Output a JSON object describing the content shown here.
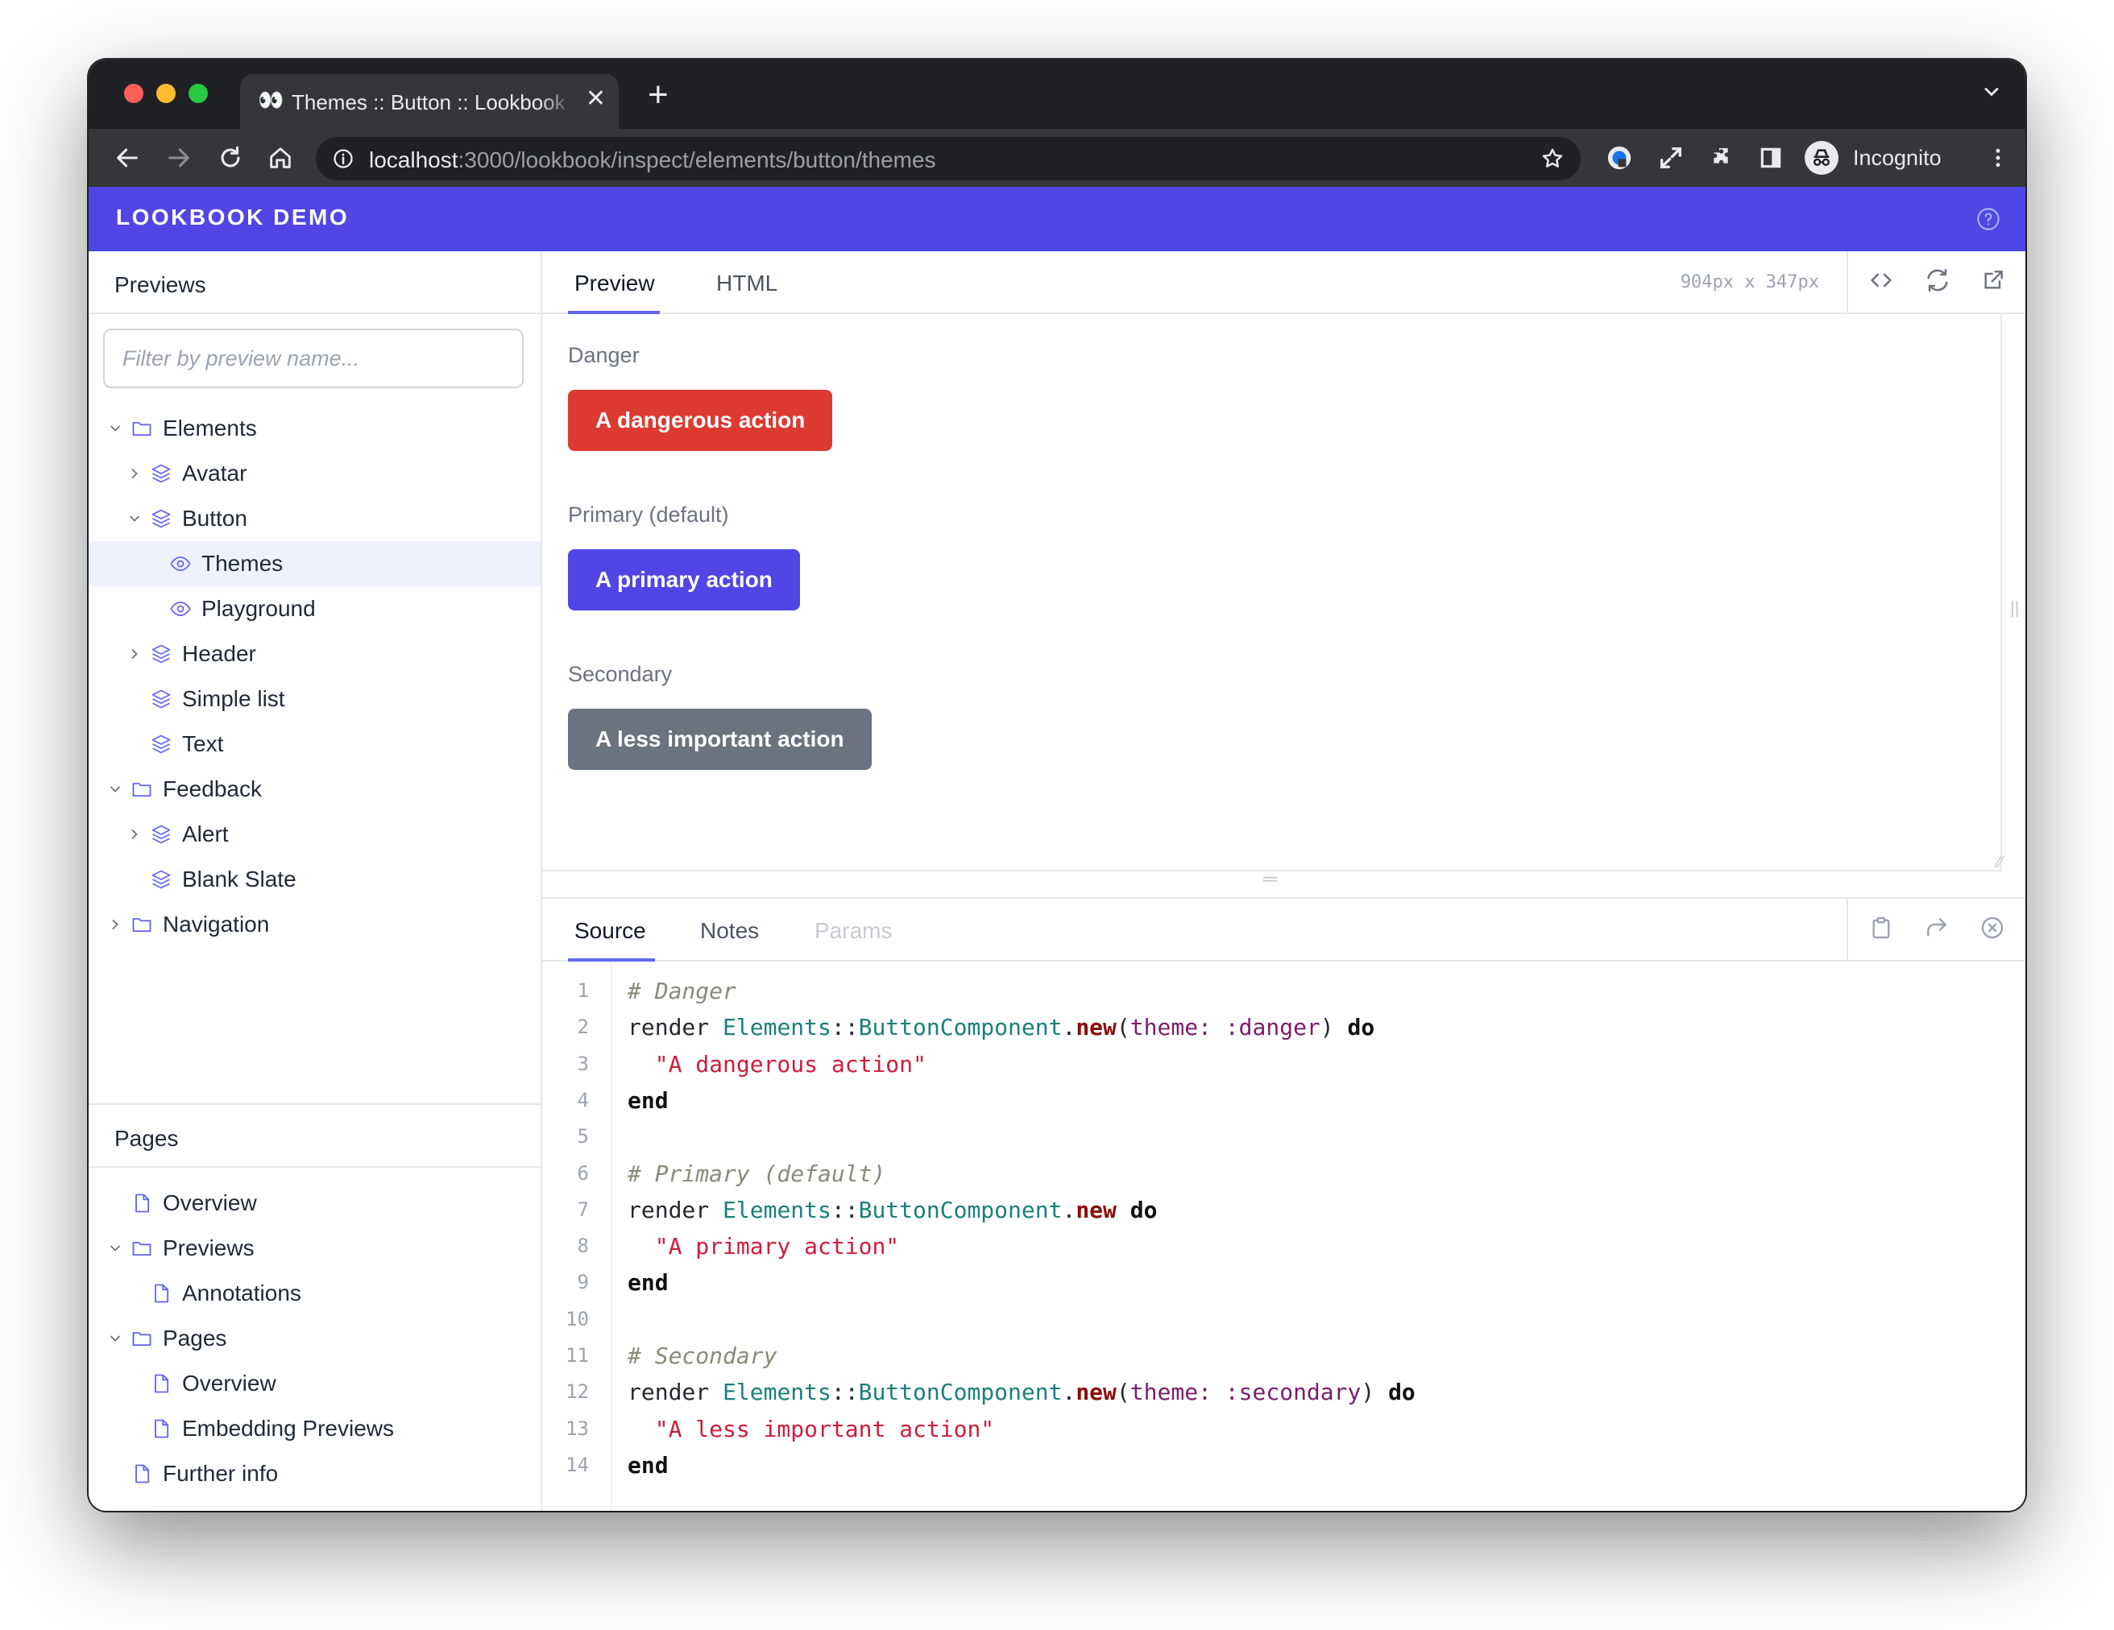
{
  "browser": {
    "tab_title": "Themes :: Button :: Lookbook Demo",
    "tab_favicon": "👀",
    "url_host": "localhost",
    "url_rest": ":3000/lookbook/inspect/elements/button/themes",
    "profile_label": "Incognito"
  },
  "app": {
    "title": "LOOKBOOK DEMO",
    "accent_color": "#4f46e5"
  },
  "sidebar": {
    "previews_heading": "Previews",
    "filter_placeholder": "Filter by preview name...",
    "tree": [
      {
        "label": "Elements",
        "icon": "folder-icon",
        "chevron": "down"
      },
      {
        "label": "Avatar",
        "icon": "layers-icon",
        "chevron": "right"
      },
      {
        "label": "Button",
        "icon": "layers-icon",
        "chevron": "down"
      },
      {
        "label": "Themes",
        "icon": "eye-icon",
        "chevron": "",
        "active": true
      },
      {
        "label": "Playground",
        "icon": "eye-icon",
        "chevron": ""
      },
      {
        "label": "Header",
        "icon": "layers-icon",
        "chevron": "right"
      },
      {
        "label": "Simple list",
        "icon": "layers-icon",
        "chevron": ""
      },
      {
        "label": "Text",
        "icon": "layers-icon",
        "chevron": ""
      },
      {
        "label": "Feedback",
        "icon": "folder-icon",
        "chevron": "down"
      },
      {
        "label": "Alert",
        "icon": "layers-icon",
        "chevron": "right"
      },
      {
        "label": "Blank Slate",
        "icon": "layers-icon",
        "chevron": ""
      },
      {
        "label": "Navigation",
        "icon": "folder-icon",
        "chevron": "right"
      }
    ],
    "pages_heading": "Pages",
    "pages": [
      {
        "label": "Overview",
        "icon": "file-icon"
      },
      {
        "label": "Previews",
        "icon": "folder-icon",
        "chevron": "down"
      },
      {
        "label": "Annotations",
        "icon": "file-icon"
      },
      {
        "label": "Pages",
        "icon": "folder-icon",
        "chevron": "down"
      },
      {
        "label": "Overview",
        "icon": "file-icon"
      },
      {
        "label": "Embedding Previews",
        "icon": "file-icon"
      },
      {
        "label": "Further info",
        "icon": "file-icon"
      }
    ]
  },
  "main": {
    "tabs": [
      "Preview",
      "HTML"
    ],
    "dimensions": "904px x 347px",
    "preview": {
      "sections": [
        {
          "label": "Danger",
          "button": "A dangerous action",
          "color": "#dc3a31"
        },
        {
          "label": "Primary (default)",
          "button": "A primary action",
          "color": "#4f46e5"
        },
        {
          "label": "Secondary",
          "button": "A less important action",
          "color": "#6b7280"
        }
      ]
    },
    "bottom_tabs": [
      "Source",
      "Notes",
      "Params"
    ],
    "source": {
      "line_numbers": [
        "1",
        "2",
        "3",
        "4",
        "5",
        "6",
        "7",
        "8",
        "9",
        "10",
        "11",
        "12",
        "13",
        "14"
      ],
      "lines": [
        [
          {
            "t": "# Danger",
            "c": "comment"
          }
        ],
        [
          {
            "t": "render ",
            "c": "plain"
          },
          {
            "t": "Elements",
            "c": "const"
          },
          {
            "t": "::",
            "c": "plain"
          },
          {
            "t": "ButtonComponent",
            "c": "const"
          },
          {
            "t": ".",
            "c": "plain"
          },
          {
            "t": "new",
            "c": "meth"
          },
          {
            "t": "(",
            "c": "plain"
          },
          {
            "t": "theme:",
            "c": "sym"
          },
          {
            "t": " ",
            "c": "plain"
          },
          {
            "t": ":danger",
            "c": "sym"
          },
          {
            "t": ") ",
            "c": "plain"
          },
          {
            "t": "do",
            "c": "kw"
          }
        ],
        [
          {
            "t": "  ",
            "c": "plain"
          },
          {
            "t": "\"A dangerous action\"",
            "c": "str"
          }
        ],
        [
          {
            "t": "end",
            "c": "kw"
          }
        ],
        [],
        [
          {
            "t": "# Primary (default)",
            "c": "comment"
          }
        ],
        [
          {
            "t": "render ",
            "c": "plain"
          },
          {
            "t": "Elements",
            "c": "const"
          },
          {
            "t": "::",
            "c": "plain"
          },
          {
            "t": "ButtonComponent",
            "c": "const"
          },
          {
            "t": ".",
            "c": "plain"
          },
          {
            "t": "new",
            "c": "meth"
          },
          {
            "t": " ",
            "c": "plain"
          },
          {
            "t": "do",
            "c": "kw"
          }
        ],
        [
          {
            "t": "  ",
            "c": "plain"
          },
          {
            "t": "\"A primary action\"",
            "c": "str"
          }
        ],
        [
          {
            "t": "end",
            "c": "kw"
          }
        ],
        [],
        [
          {
            "t": "# Secondary",
            "c": "comment"
          }
        ],
        [
          {
            "t": "render ",
            "c": "plain"
          },
          {
            "t": "Elements",
            "c": "const"
          },
          {
            "t": "::",
            "c": "plain"
          },
          {
            "t": "ButtonComponent",
            "c": "const"
          },
          {
            "t": ".",
            "c": "plain"
          },
          {
            "t": "new",
            "c": "meth"
          },
          {
            "t": "(",
            "c": "plain"
          },
          {
            "t": "theme:",
            "c": "sym"
          },
          {
            "t": " ",
            "c": "plain"
          },
          {
            "t": ":secondary",
            "c": "sym"
          },
          {
            "t": ") ",
            "c": "plain"
          },
          {
            "t": "do",
            "c": "kw"
          }
        ],
        [
          {
            "t": "  ",
            "c": "plain"
          },
          {
            "t": "\"A less important action\"",
            "c": "str"
          }
        ],
        [
          {
            "t": "end",
            "c": "kw"
          }
        ]
      ]
    }
  }
}
